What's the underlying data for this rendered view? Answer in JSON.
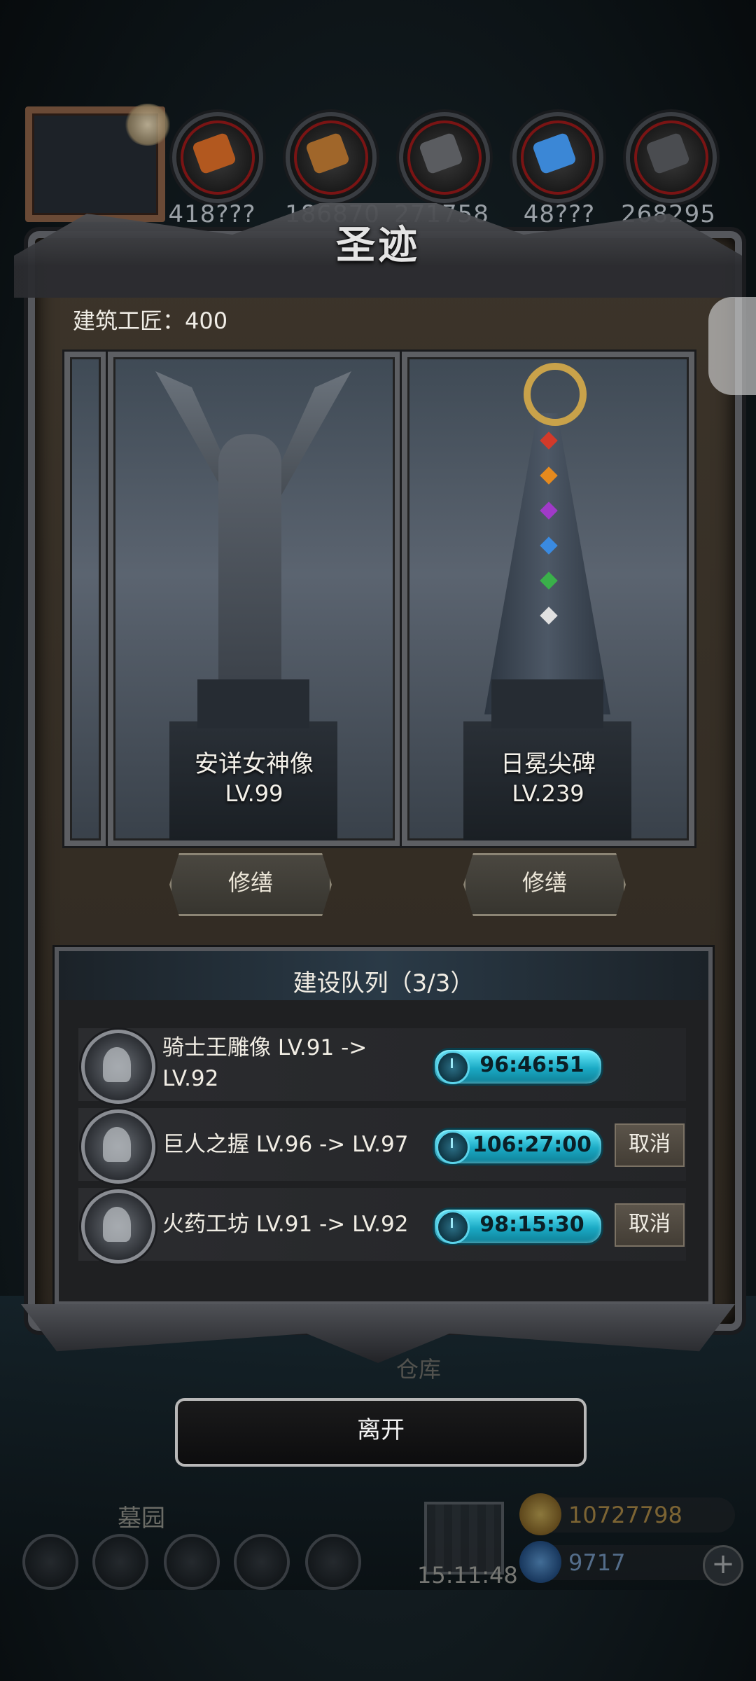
{
  "top_bar": {
    "resources": [
      {
        "value": "418???",
        "icon": "meat-icon",
        "color": "#b2581f"
      },
      {
        "value": "186870",
        "icon": "wood-icon",
        "color": "#a0662a"
      },
      {
        "value": "271758",
        "icon": "stone-icon",
        "color": "#5a5c60"
      },
      {
        "value": "48???",
        "icon": "crystal-icon",
        "color": "#3b87d6"
      },
      {
        "value": "268295",
        "icon": "iron-icon",
        "color": "#4a4c50"
      }
    ]
  },
  "panel": {
    "title": "圣迹",
    "builders": "建筑工匠：400"
  },
  "monuments": [
    {
      "name": "安详女神像",
      "level": "LV.99",
      "action": "修缮"
    },
    {
      "name": "日冕尖碑",
      "level": "LV.239",
      "action": "修缮"
    }
  ],
  "queue": {
    "title": "建设队列（3/3）",
    "items": [
      {
        "label": "骑士王雕像 LV.91 -> LV.92",
        "timer": "96:46:51",
        "cancel": ""
      },
      {
        "label": "巨人之握 LV.96 -> LV.97",
        "timer": "106:27:00",
        "cancel": "取消"
      },
      {
        "label": "火药工坊 LV.91 -> LV.92",
        "timer": "98:15:30",
        "cancel": "取消"
      }
    ]
  },
  "background_labels": {
    "warehouse": "仓库",
    "cemetery": "墓园"
  },
  "leave_button": "离开",
  "hud": {
    "clock": "15:11:48",
    "gold": "10727798",
    "gems": "9717",
    "plus": "+"
  },
  "colors": {
    "panel_bg": "#3c342a",
    "timer": "#1aa9c4",
    "frame": "#55575c"
  }
}
